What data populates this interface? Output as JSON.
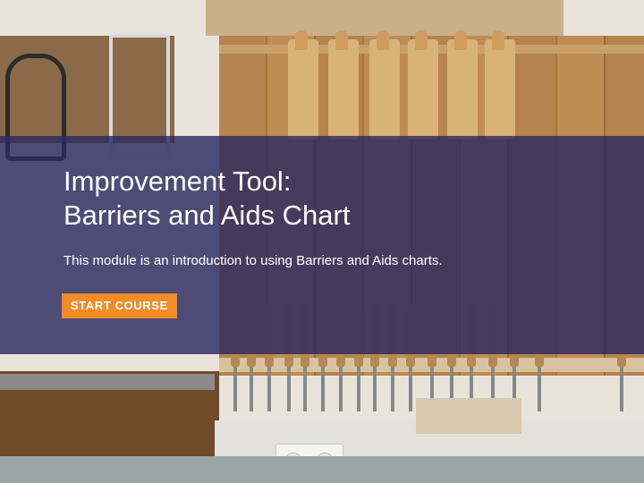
{
  "course": {
    "title_line1": "Improvement Tool:",
    "title_line2": "Barriers and Aids Chart",
    "description": "This module is an introduction to using Barriers and Aids charts.",
    "start_label": "START COURSE"
  },
  "colors": {
    "overlay": "#2c295f",
    "button": "#f28c28",
    "text": "#ffffff"
  }
}
